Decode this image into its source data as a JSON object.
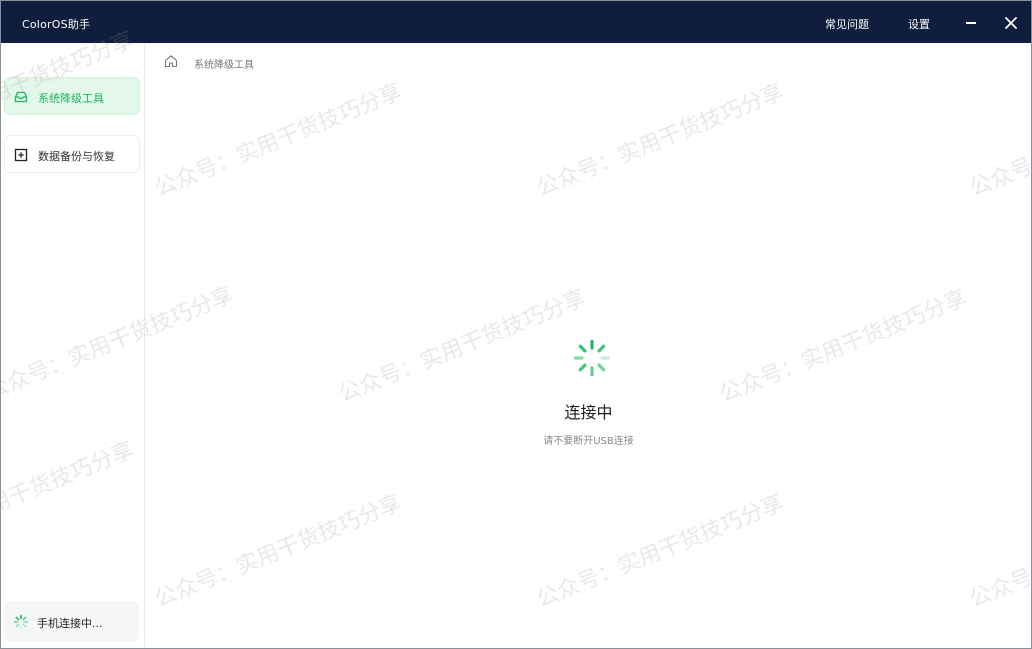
{
  "window": {
    "title": "ColorOS助手",
    "faq_label": "常见问题",
    "settings_label": "设置"
  },
  "sidebar": {
    "items": [
      {
        "label": "系统降级工具",
        "icon": "inbox-icon",
        "active": true
      },
      {
        "label": "数据备份与恢复",
        "icon": "plus-square-icon",
        "active": false
      }
    ],
    "status": "手机连接中..."
  },
  "main": {
    "breadcrumb": "系统降级工具",
    "status_title": "连接中",
    "status_hint": "请不要断开USB连接"
  },
  "watermark_text": "公众号：实用干货技巧分享",
  "colors": {
    "titlebar_bg": "#0f1e3d",
    "accent_green": "#21b45c",
    "active_item_bg": "#e3f8ea"
  }
}
